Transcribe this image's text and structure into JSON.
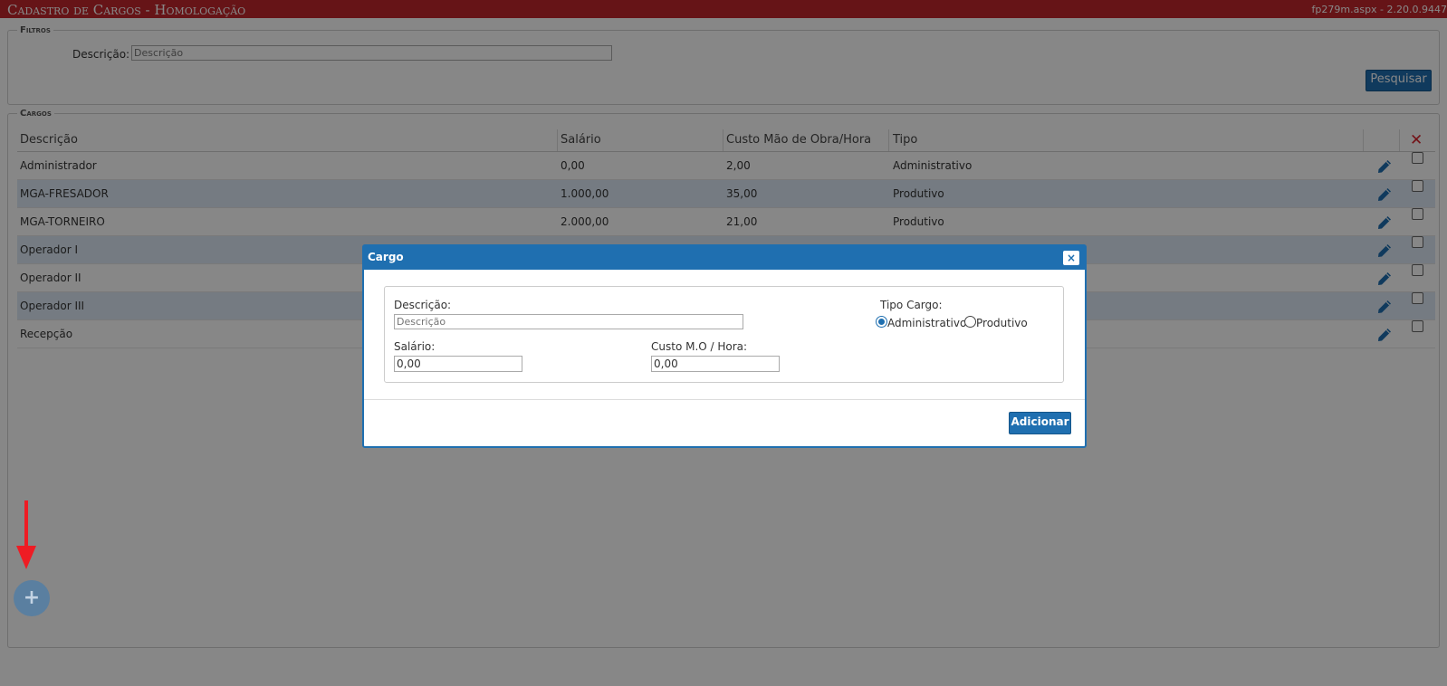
{
  "header": {
    "title": "Cadastro de Cargos  - Homologação",
    "version": "fp279m.aspx - 2.20.0.9447",
    "color": "#c1272d"
  },
  "filtros": {
    "legend": "Filtros",
    "descricao_label": "Descrição:",
    "descricao_placeholder": "Descrição",
    "pesquisar_label": "Pesquisar"
  },
  "cargos": {
    "legend": "Cargos",
    "columns": [
      "Descrição",
      "Salário",
      "Custo Mão de Obra/Hora",
      "Tipo"
    ],
    "delete_icon": "✕",
    "rows": [
      {
        "descricao": "Administrador",
        "salario": "0,00",
        "custo": "2,00",
        "tipo": "Administrativo"
      },
      {
        "descricao": "MGA-FRESADOR",
        "salario": "1.000,00",
        "custo": "35,00",
        "tipo": "Produtivo"
      },
      {
        "descricao": "MGA-TORNEIRO",
        "salario": "2.000,00",
        "custo": "21,00",
        "tipo": "Produtivo"
      },
      {
        "descricao": "Operador I",
        "salario": "",
        "custo": "",
        "tipo": ""
      },
      {
        "descricao": "Operador II",
        "salario": "",
        "custo": "",
        "tipo": ""
      },
      {
        "descricao": "Operador III",
        "salario": "",
        "custo": "",
        "tipo": ""
      },
      {
        "descricao": "Recepção",
        "salario": "",
        "custo": "",
        "tipo": ""
      }
    ]
  },
  "fab": {
    "label": "+"
  },
  "modal": {
    "title": "Cargo",
    "close": "×",
    "descricao_label": "Descrição:",
    "descricao_placeholder": "Descrição",
    "tipo_label": "Tipo Cargo:",
    "tipo_options": [
      "Administrativo",
      "Produtivo"
    ],
    "tipo_selected": "Administrativo",
    "salario_label": "Salário:",
    "salario_value": "0,00",
    "custo_label": "Custo M.O / Hora:",
    "custo_value": "0,00",
    "adicionar_label": "Adicionar"
  },
  "icons": {
    "edit": "pencil-icon",
    "arrow": "red-down-arrow",
    "accent": "#1f6fb0"
  }
}
